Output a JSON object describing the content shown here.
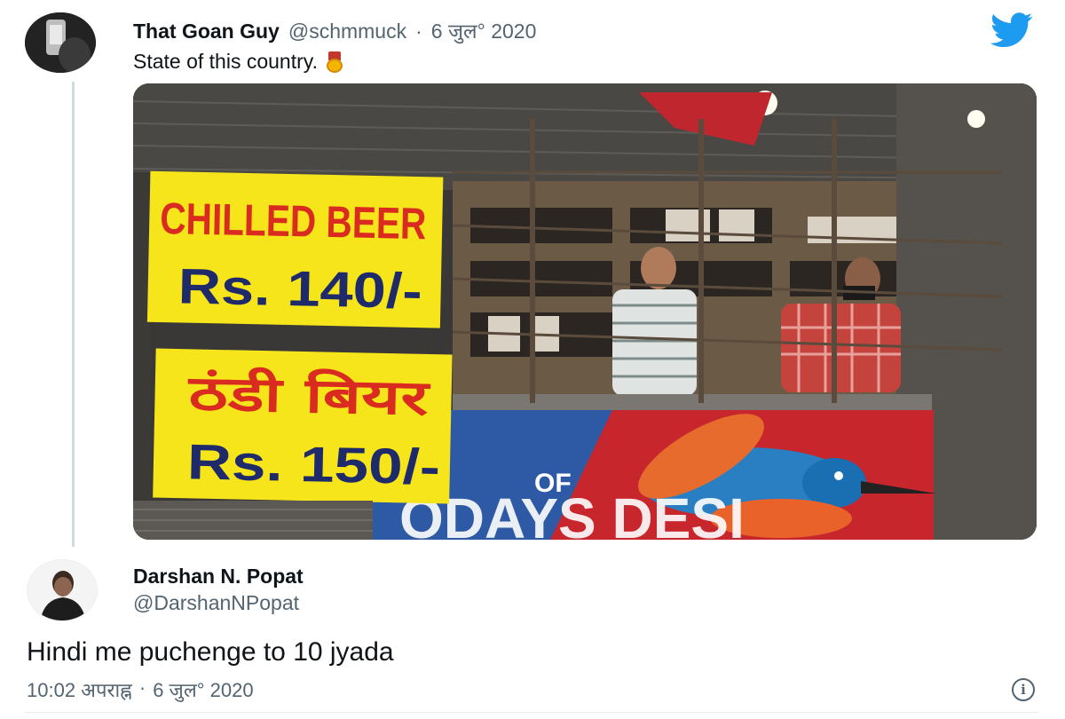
{
  "parent_tweet": {
    "author_name": "That Goan Guy",
    "handle": "@schmmuck",
    "separator": "·",
    "date": "6 जुल° 2020",
    "text": "State of this country.",
    "emoji": "medal-emoji"
  },
  "photo": {
    "sign_english_line1": "CHILLED BEER",
    "sign_english_line2": "Rs. 140/-",
    "sign_hindi_line1": "ठंडी बियर",
    "sign_hindi_line2": "Rs. 150/-",
    "banner_text_small": "OF",
    "banner_text_large": "ODAYS DESI"
  },
  "reply_tweet": {
    "author_name": "Darshan N. Popat",
    "handle": "@DarshanNPopat",
    "text": "Hindi me puchenge to 10 jyada",
    "time": "10:02 अपराह्न",
    "separator": "·",
    "date": "6 जुल° 2020",
    "info_label": "i"
  },
  "icons": {
    "brand": "twitter-bird-icon",
    "info": "info-icon"
  },
  "colors": {
    "twitter_blue": "#1d9bf0",
    "text_primary": "#0f1419",
    "text_secondary": "#536471",
    "sign_yellow": "#f7e51b",
    "sign_red": "#d92b1f",
    "sign_navy": "#1f2a6b"
  }
}
